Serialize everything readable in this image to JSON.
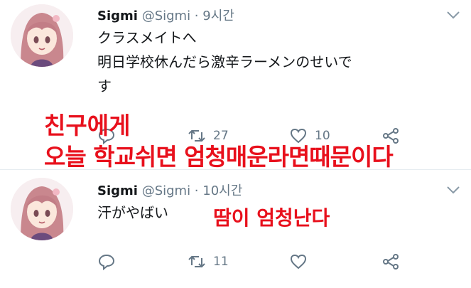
{
  "tweets": [
    {
      "name": "Sigmi",
      "meta": "@Sigmi · 9시간",
      "lines": [
        "クラスメイトへ",
        "明日学校休んだら激辛ラーメンのせいで",
        "す"
      ],
      "reply_count": "",
      "retweet_count": "27",
      "like_count": "10"
    },
    {
      "name": "Sigmi",
      "meta": "@Sigmi · 10시간",
      "lines": [
        "汗がやばい"
      ],
      "reply_count": "",
      "retweet_count": "11",
      "like_count": ""
    }
  ],
  "overlays": {
    "line1": "친구에게",
    "line2": "오늘 학교쉬면 엄청매운라면때문이다",
    "line3": "땀이 엄청난다"
  },
  "icons": {
    "reply": "reply-icon",
    "retweet": "retweet-icon",
    "like": "heart-icon",
    "share": "share-icon",
    "caret": "chevron-down-icon"
  },
  "colors": {
    "overlay_red": "#e8101c",
    "meta_gray": "#657786",
    "text": "#14171a"
  }
}
